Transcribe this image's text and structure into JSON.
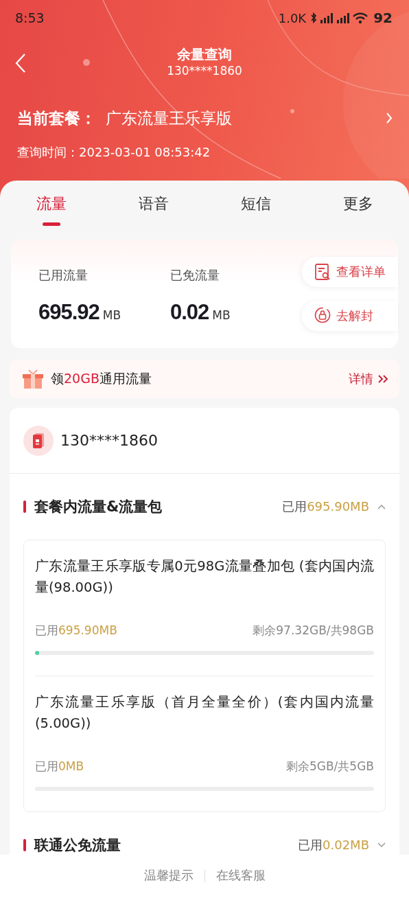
{
  "status_bar": {
    "time": "8:53",
    "net_speed": "1.0K",
    "battery": "92"
  },
  "nav": {
    "title": "余量查询",
    "subtitle": "130****1860"
  },
  "plan": {
    "label": "当前套餐：",
    "name": "广东流量王乐享版"
  },
  "query_time": "查询时间：2023-03-01 08:53:42",
  "tabs": [
    {
      "label": "流量",
      "selected": true
    },
    {
      "label": "语音",
      "selected": false
    },
    {
      "label": "短信",
      "selected": false
    },
    {
      "label": "更多",
      "selected": false
    }
  ],
  "usage": {
    "stats": [
      {
        "label": "已用流量",
        "value": "695.92",
        "unit": "MB"
      },
      {
        "label": "已免流量",
        "value": "0.02",
        "unit": "MB"
      }
    ],
    "actions": [
      {
        "kind": "detail",
        "label": "查看详单"
      },
      {
        "kind": "unlock",
        "label": "去解封"
      }
    ]
  },
  "promo": {
    "prefix": "领",
    "highlight": "20GB",
    "suffix": "通用流量",
    "link": "详情"
  },
  "account": {
    "phone": "130****1860"
  },
  "sections": [
    {
      "title": "套餐内流量&流量包",
      "used_label": "已用",
      "used_value": "695.90MB",
      "expanded": true,
      "packages": [
        {
          "name": "广东流量王乐享版专属0元98G流量叠加包 (套内国内流量(98.00G))",
          "used_label": "已用",
          "used_value": "695.90MB",
          "remaining": "剩余97.32GB/共98GB",
          "level": 0.012
        },
        {
          "name": "广东流量王乐享版（首月全量全价）(套内国内流量(5.00G))",
          "used_label": "已用",
          "used_value": "0MB",
          "remaining": "剩余5GB/共5GB",
          "level": 0
        }
      ]
    },
    {
      "title": "联通公免流量",
      "used_label": "已用",
      "used_value": "0.02MB",
      "expanded": false
    }
  ],
  "footer": [
    "温馨提示",
    "在线客服"
  ]
}
